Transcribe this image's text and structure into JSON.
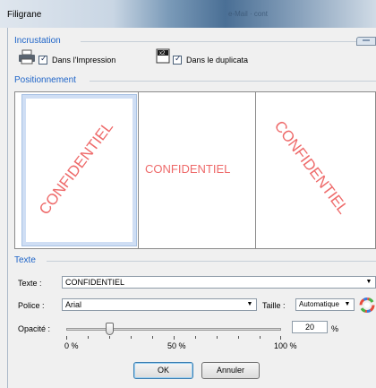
{
  "window": {
    "title": "Filigrane",
    "ghost_title": "e-Mail · cont"
  },
  "incrustation": {
    "title": "Incrustation",
    "print_label": "Dans l'Impression",
    "print_checked": true,
    "duplicate_label": "Dans le duplicata",
    "duplicate_checked": true
  },
  "positionnement": {
    "title": "Positionnement",
    "watermark_text": "CONFIDENTIEL",
    "selected_position": "diagonale-montante",
    "positions": [
      "diagonale-montante",
      "horizontale",
      "diagonale-descendante"
    ]
  },
  "texte": {
    "title": "Texte",
    "text_label": "Texte :",
    "text_value": "CONFIDENTIEL",
    "font_label": "Police :",
    "font_value": "Arial",
    "size_label": "Taille :",
    "size_value": "Automatique",
    "opacity_label": "Opacité :",
    "opacity_value": "20",
    "opacity_unit": "%",
    "opacity_fraction": 0.2,
    "scale_min": "0 %",
    "scale_mid": "50 %",
    "scale_max": "100 %"
  },
  "buttons": {
    "ok": "OK",
    "cancel": "Annuler"
  },
  "colors": {
    "section_title": "#1e64c8",
    "watermark": "#ee6a6a",
    "selection": "#cfdef4"
  }
}
